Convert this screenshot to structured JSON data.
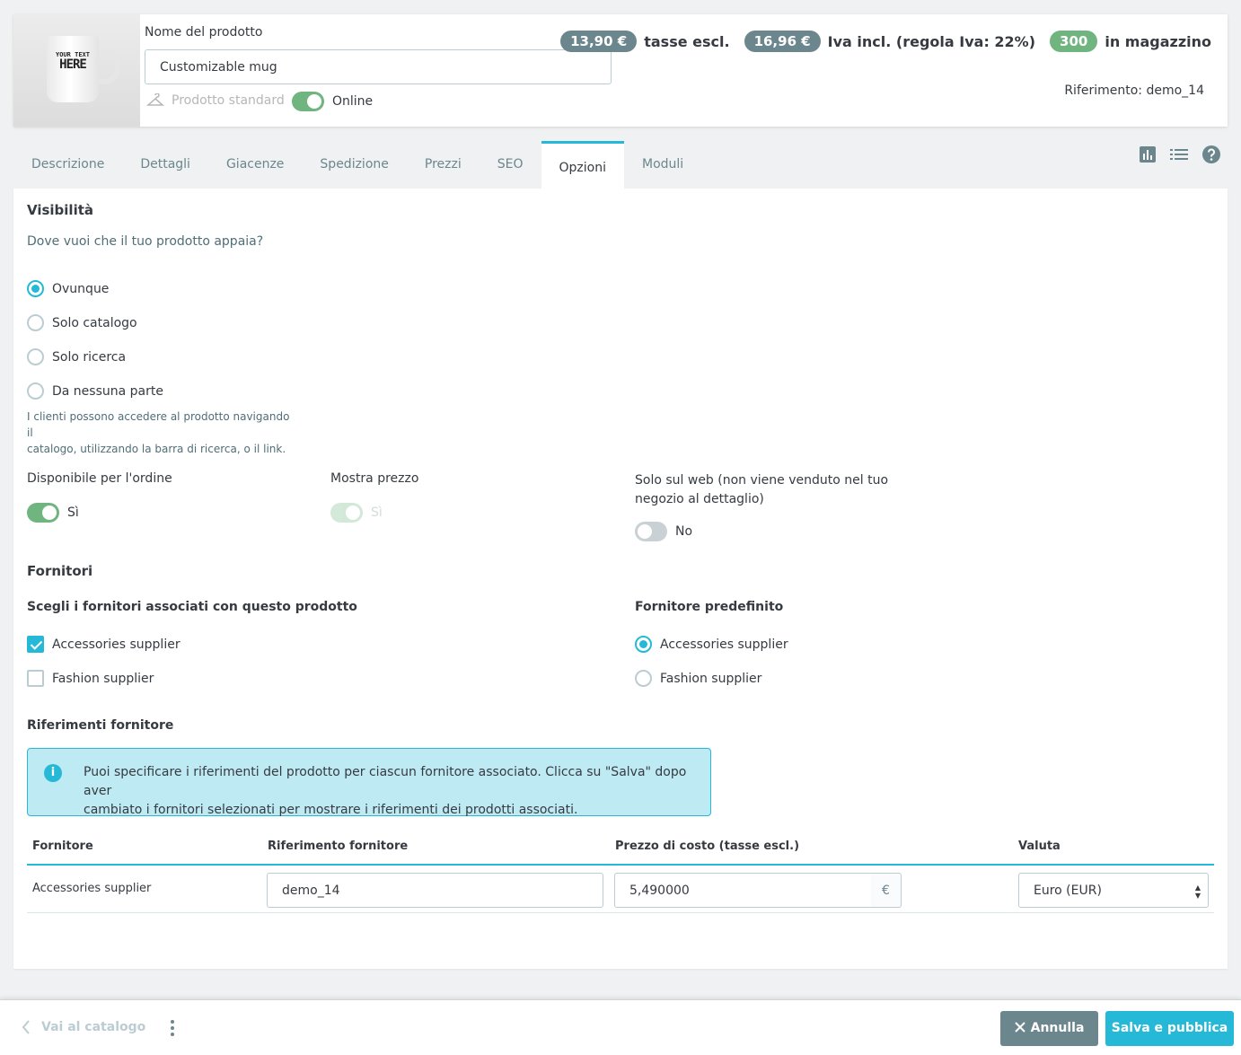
{
  "header": {
    "thumbnail": {
      "line1": "YOUR TEXT",
      "line2": "HERE"
    },
    "name_label": "Nome del prodotto",
    "name_value": "Customizable mug",
    "product_type": "Prodotto standard",
    "online_label": "Online",
    "online_enabled": true,
    "price_excl": "13,90 €",
    "price_excl_label": "tasse escl.",
    "price_incl": "16,96 €",
    "price_incl_label": "Iva incl. (regola Iva: 22%)",
    "stock": "300",
    "stock_label": "in magazzino",
    "reference": "Riferimento: demo_14"
  },
  "tabs": [
    "Descrizione",
    "Dettagli",
    "Giacenze",
    "Spedizione",
    "Prezzi",
    "SEO",
    "Opzioni",
    "Moduli"
  ],
  "active_tab": "Opzioni",
  "header_icons": [
    "chart-icon",
    "list-icon",
    "help-icon"
  ],
  "visibility": {
    "title": "Visibilità",
    "question": "Dove vuoi che il tuo prodotto appaia?",
    "options": [
      "Ovunque",
      "Solo catalogo",
      "Solo ricerca",
      "Da nessuna parte"
    ],
    "selected": "Ovunque",
    "help_line1": "I clienti possono accedere al prodotto navigando il",
    "help_line2": "catalogo, utilizzando la barra di ricerca, o il link."
  },
  "switches": {
    "available_label": "Disponibile per l'ordine",
    "available_value": "Sì",
    "show_price_label": "Mostra prezzo",
    "show_price_value": "Sì",
    "web_only_label_line1": "Solo sul web (non viene venduto nel tuo",
    "web_only_label_line2": "negozio al dettaglio)",
    "web_only_value": "No"
  },
  "suppliers": {
    "title": "Fornitori",
    "choose_label": "Scegli i fornitori associati con questo prodotto",
    "default_label": "Fornitore predefinito",
    "list": [
      "Accessories supplier",
      "Fashion supplier"
    ],
    "checked": [
      "Accessories supplier"
    ],
    "default": "Accessories supplier"
  },
  "references": {
    "title": "Riferimenti fornitore",
    "info_line1": "Puoi specificare i riferimenti del prodotto per ciascun fornitore associato. Clicca su \"Salva\" dopo aver",
    "info_line2": "cambiato i fornitori selezionati per mostrare i riferimenti dei prodotti associati.",
    "columns": [
      "Fornitore",
      "Riferimento fornitore",
      "Prezzo di costo (tasse escl.)",
      "Valuta"
    ],
    "rows": [
      {
        "supplier": "Accessories supplier",
        "reference": "demo_14",
        "cost": "5,490000",
        "currency_symbol": "€",
        "currency": "Euro (EUR)"
      }
    ]
  },
  "footer": {
    "back_label": "Vai al catalogo",
    "cancel_label": "Annulla",
    "save_label": "Salva e pubblica"
  },
  "colors": {
    "primary": "#25b9d7",
    "success": "#70b580",
    "secondary": "#6c868e"
  }
}
